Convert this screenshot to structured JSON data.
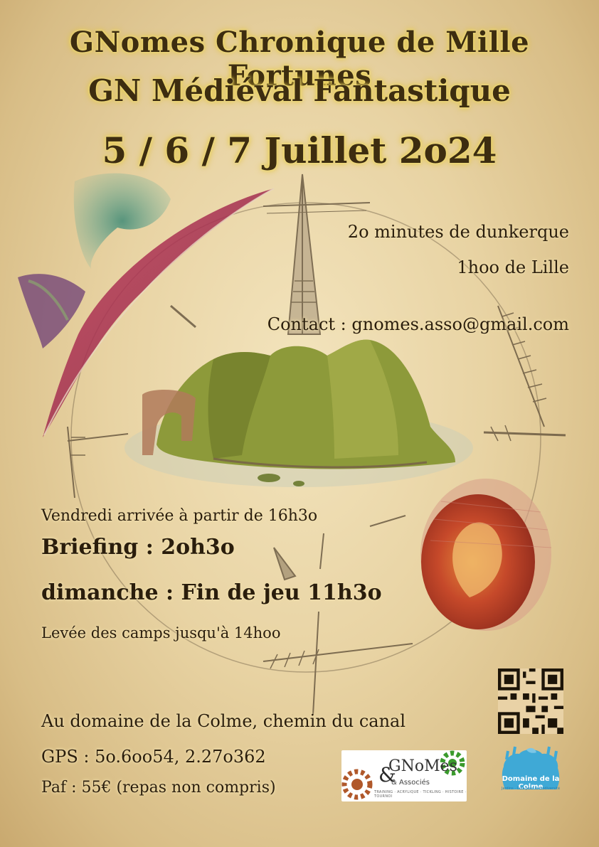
{
  "title": {
    "line1": "GNomes Chronique de Mille Fortunes",
    "line2": "GN Médiéval Fantastique",
    "line3": "5 / 6 / 7 Juillet 2o24"
  },
  "location": {
    "distance_dunkerque": "2o minutes de dunkerque",
    "distance_lille": "1hoo de Lille",
    "contact": "Contact : gnomes.asso@gmail.com"
  },
  "schedule": {
    "arrival": "Vendredi arrivée à partir de 16h3o",
    "briefing": "Briefing : 2oh3o",
    "end": "dimanche : Fin de jeu 11h3o",
    "camps": "Levée des camps jusqu'à 14hoo"
  },
  "venue": {
    "address": "Au domaine de la Colme, chemin du canal",
    "gps": "GPS : 5o.6oo54, 2.27o362",
    "paf": "Paf : 55€ (repas non compris)"
  },
  "logos": {
    "gnomes_text": "GNoMes",
    "gnomes_sub": "& Associés",
    "gnomes_tagline": "TRAINING · ACRYLIQUE · TICKLING · HISTOIRE · TOURNOI",
    "colme_name": "Domaine de la Colme",
    "colme_tagline": "Jardins · Cols pour la biodiversité"
  },
  "colors": {
    "parchment": "#e8d3a3",
    "title_glow": "#e8cf52",
    "ink": "#2a1d0c"
  },
  "icons": [
    "compass-rose-illustration",
    "island-illustration",
    "feather-illustration",
    "dragon-egg-illustration",
    "qr-code",
    "gear-icon"
  ]
}
